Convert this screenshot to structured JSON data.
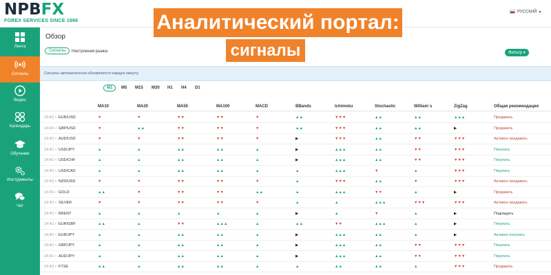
{
  "brand": {
    "logo_text": "NPBFX",
    "logo_npb": "NPB",
    "logo_fx": "FX",
    "tagline": "FOREX SERVICES SINCE 1996",
    "accent": "#1aa37a",
    "highlight": "#f0822a"
  },
  "banner": {
    "line1": "Аналитический портал:",
    "line2": "сигналы"
  },
  "language": {
    "label": "РУССКИЙ",
    "flag": "russia-flag"
  },
  "sidebar": {
    "items": [
      {
        "label": "Лента",
        "icon": "grid-icon",
        "active": false
      },
      {
        "label": "Сигналы",
        "icon": "signal-icon",
        "active": true
      },
      {
        "label": "Видео",
        "icon": "play-icon",
        "active": false
      },
      {
        "label": "Календарь",
        "icon": "calendar-icon",
        "active": false
      },
      {
        "label": "Обучение",
        "icon": "graduation-cap-icon",
        "active": false
      },
      {
        "label": "Инструменты",
        "icon": "gears-icon",
        "active": false
      },
      {
        "label": "Чат",
        "icon": "chat-icon",
        "active": false
      }
    ]
  },
  "main": {
    "title": "Обзор",
    "tabs": [
      {
        "label": "Сигналы",
        "active": true
      },
      {
        "label": "Настроения рынка",
        "active": false
      }
    ],
    "filter_label": "Фильтр",
    "info": "Сигналы автоматически обновляются каждую минуту",
    "timeframes": [
      "M1",
      "M5",
      "M15",
      "M30",
      "H1",
      "H4",
      "D1"
    ],
    "active_timeframe": "M1"
  },
  "table": {
    "columns": [
      "MA10",
      "MA20",
      "MA50",
      "MA100",
      "MACD",
      "BBands",
      "Ichimoku",
      "Stochastic",
      "William`s",
      "ZigZag",
      "Общая рекомендация"
    ],
    "rows": [
      {
        "time": "14:43",
        "symbol": "EUR/USD",
        "signals": [
          "▼",
          "▼",
          "▼▼",
          "▼▼",
          "▼",
          "▲▲",
          "▼▼▼",
          "▲▲",
          "▲▲",
          "▲▲▲"
        ],
        "rec": "Продавать",
        "rec_type": "sell"
      },
      {
        "time": "14:43",
        "symbol": "GBP/USD",
        "signals": [
          "▼",
          "▲▲",
          "▼▼",
          "▼▼",
          "▼",
          "▲▲",
          "▼▼▼",
          "▲▲",
          "▲▲",
          "▶"
        ],
        "rec": "Продавать",
        "rec_type": "sell"
      },
      {
        "time": "14:43",
        "symbol": "AUD/USD",
        "signals": [
          "▼",
          "▼",
          "▼▼",
          "▼▼",
          "▼",
          "▶",
          "▼▼▼",
          "▲▲",
          "▼▼",
          "▼▼▼"
        ],
        "rec": "Активно продавать",
        "rec_type": "sell"
      },
      {
        "time": "14:42",
        "symbol": "USD/JPY",
        "signals": [
          "▲",
          "▲",
          "▲▲",
          "▲▲",
          "▲",
          "▶",
          "▲▲▲",
          "▲▲",
          "▼▼",
          "▼▼▼"
        ],
        "rec": "Покупать",
        "rec_type": "buy"
      },
      {
        "time": "14:42",
        "symbol": "USD/CHF",
        "signals": [
          "▲",
          "▲",
          "▲▲",
          "▲▲",
          "▲",
          "▶",
          "▲▲▲",
          "▲▲",
          "▼▼",
          "▼▼▼"
        ],
        "rec": "Покупать",
        "rec_type": "buy"
      },
      {
        "time": "14:43",
        "symbol": "USD/CAD",
        "signals": [
          "▲",
          "▲",
          "▲▲",
          "▲▲",
          "▲",
          "▲",
          "▲▲▲",
          "▼",
          "▲",
          "▼▼▼"
        ],
        "rec": "Покупать",
        "rec_type": "buy"
      },
      {
        "time": "14:43",
        "symbol": "NZD/USD",
        "signals": [
          "▼",
          "▼",
          "▼▼",
          "▼▼",
          "▼",
          "▲",
          "▼▼▼",
          "▲▲",
          "▼",
          "▼▼▼"
        ],
        "rec": "Активно продавать",
        "rec_type": "sell"
      },
      {
        "time": "14:43",
        "symbol": "GOLD",
        "signals": [
          "▲▲",
          "▼",
          "▼▼",
          "▼▼",
          "▲▲",
          "▲",
          "▲▲▲",
          "▼▼",
          "▲",
          "▶"
        ],
        "rec": "Продавать",
        "rec_type": "sell"
      },
      {
        "time": "14:43",
        "symbol": "SILVER",
        "signals": [
          "▼",
          "▼",
          "▼▼",
          "▼▼",
          "▼",
          "▲",
          "▲",
          "▲▲▲",
          "▼▼▼",
          "▼▼▼"
        ],
        "rec": "Активно продавать",
        "rec_type": "sell"
      },
      {
        "time": "14:43",
        "symbol": "BRENT",
        "signals": [
          "▲",
          "▲",
          "▲",
          "▲",
          "▲",
          "▶",
          "▲",
          "▼",
          "▲",
          "▶"
        ],
        "rec": "Подождать",
        "rec_type": "wait"
      },
      {
        "time": "14:43",
        "symbol": "EUR/GBP",
        "signals": [
          "▲▲",
          "▲",
          "▼▼",
          "▲▲▲",
          "▲",
          "▲▲",
          "▼▼",
          "▲▲▲",
          "▲",
          "▶"
        ],
        "rec": "Покупать",
        "rec_type": "buy"
      },
      {
        "time": "14:42",
        "symbol": "EUR/JPY",
        "signals": [
          "▲",
          "▲",
          "▲▲",
          "▲▲",
          "▲",
          "▶",
          "▲▲▲",
          "▲▲",
          "▲",
          "▶"
        ],
        "rec": "Активно покупать",
        "rec_type": "buy"
      },
      {
        "time": "14:42",
        "symbol": "GBP/JPY",
        "signals": [
          "▲",
          "▲",
          "▲▲",
          "▲▲",
          "▲",
          "▶",
          "▲▲▲",
          "▲▲",
          "▼▼",
          "▼▼▼"
        ],
        "rec": "Покупать",
        "rec_type": "buy"
      },
      {
        "time": "14:42",
        "symbol": "AUD/JPY",
        "signals": [
          "▲",
          "▲",
          "▲▲",
          "▲▲",
          "▲",
          "▶",
          "▲▲▲",
          "▲▲",
          "▼▼",
          "▼▼▼"
        ],
        "rec": "Покупать",
        "rec_type": "buy"
      },
      {
        "time": "14:43",
        "symbol": "FTSE",
        "signals": [
          "▲▲",
          "▲",
          "▲▲",
          "▲▲",
          "▲",
          "▲",
          "▲▲",
          "▲▲",
          "▲",
          "▼▼▼"
        ],
        "rec": "Продавать",
        "rec_type": "sell"
      }
    ]
  }
}
